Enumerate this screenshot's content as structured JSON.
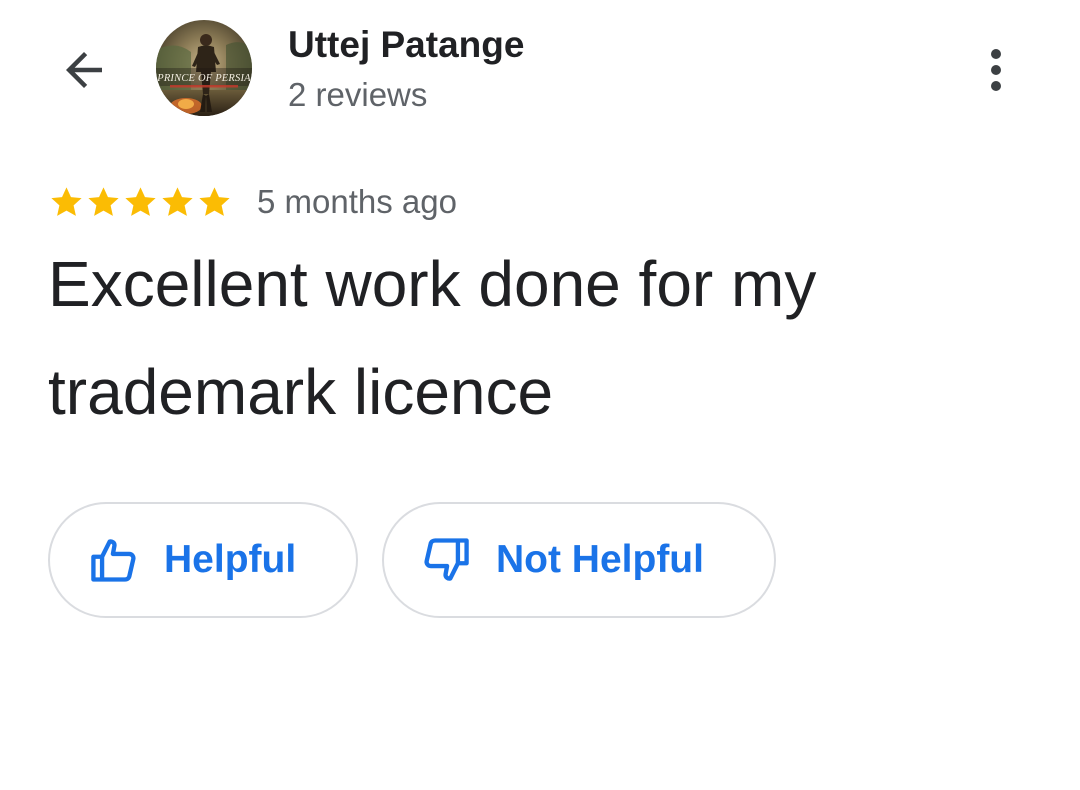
{
  "header": {
    "back_icon": "arrow-left-icon",
    "reviewer_name": "Uttej Patange",
    "review_count": "2 reviews",
    "avatar": {
      "logo_text": "PRINCE OF PERSIA"
    },
    "more_icon": "more-vert-icon"
  },
  "review": {
    "rating": 5,
    "max_rating": 5,
    "date": "5 months ago",
    "text": "Excellent work done for my trademark licence"
  },
  "actions": {
    "helpful_label": "Helpful",
    "helpful_icon": "thumb-up-icon",
    "not_helpful_label": "Not Helpful",
    "not_helpful_icon": "thumb-down-icon"
  },
  "colors": {
    "star": "#FBBC04",
    "accent": "#1A73E8",
    "text_primary": "#202124",
    "text_secondary": "#5F6368",
    "border": "#DADCE0"
  }
}
